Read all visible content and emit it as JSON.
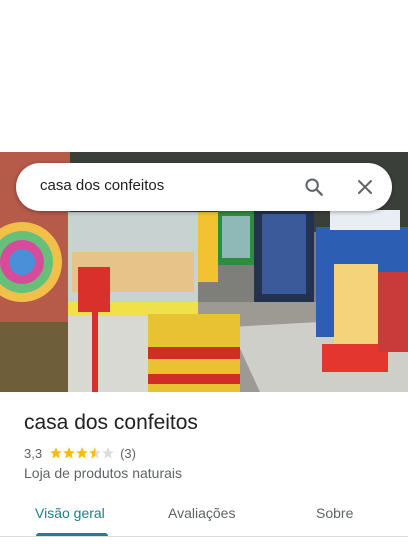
{
  "search": {
    "query": "casa dos confeitos"
  },
  "place": {
    "name": "casa dos confeitos",
    "rating": "3,3",
    "rating_value": 3.3,
    "review_count": "(3)",
    "category": "Loja de produtos naturais"
  },
  "tabs": [
    {
      "label": "Visão geral",
      "active": true
    },
    {
      "label": "Avaliações",
      "active": false
    },
    {
      "label": "Sobre",
      "active": false
    }
  ],
  "colors": {
    "accent": "#1a7f8e",
    "star": "#fbbc04",
    "star_empty": "#dadce0"
  },
  "icons": {
    "search": "search-icon",
    "close": "close-icon"
  }
}
